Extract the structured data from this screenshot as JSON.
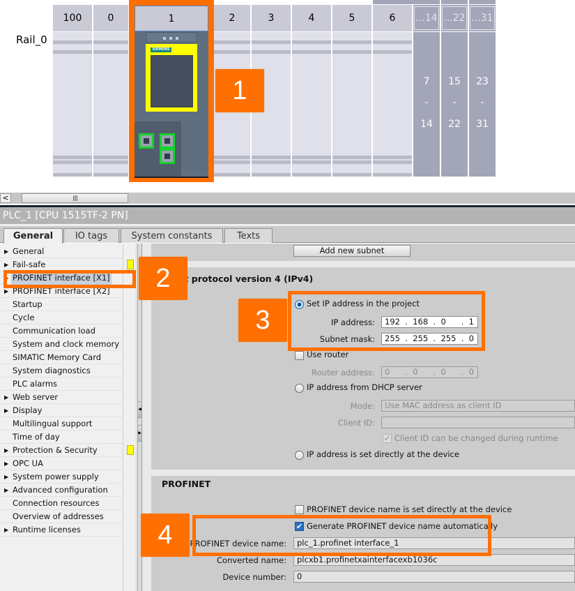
{
  "device_view": {
    "rail_label": "Rail_0",
    "slots": [
      "100",
      "0",
      "1",
      "2",
      "3",
      "4",
      "5",
      "6"
    ],
    "slot_groups": [
      {
        "header": "...14",
        "from": "7",
        "sep": "-",
        "to": "14"
      },
      {
        "header": "...22",
        "from": "15",
        "sep": "-",
        "to": "22"
      },
      {
        "header": "...31",
        "from": "23",
        "sep": "-",
        "to": "31"
      }
    ],
    "cpu_brand": "SIEMENS"
  },
  "callouts": [
    "1",
    "2",
    "3",
    "4"
  ],
  "scrollbar": {
    "left_arrow": "<",
    "thumb_grip": "||||"
  },
  "inspector": {
    "title": "PLC_1 [CPU 1515TF-2 PN]",
    "tabs": [
      {
        "label": "General",
        "active": true
      },
      {
        "label": "IO tags",
        "active": false
      },
      {
        "label": "System constants",
        "active": false
      },
      {
        "label": "Texts",
        "active": false
      }
    ],
    "nav": [
      {
        "label": "General",
        "expandable": true
      },
      {
        "label": "Fail-safe",
        "expandable": true,
        "flag": true
      },
      {
        "label": "PROFINET interface [X1]",
        "expandable": true,
        "selected": true
      },
      {
        "label": "PROFINET interface [X2]",
        "expandable": true
      },
      {
        "label": "Startup"
      },
      {
        "label": "Cycle"
      },
      {
        "label": "Communication load"
      },
      {
        "label": "System and clock memory"
      },
      {
        "label": "SIMATIC Memory Card"
      },
      {
        "label": "System diagnostics"
      },
      {
        "label": "PLC alarms"
      },
      {
        "label": "Web server",
        "expandable": true
      },
      {
        "label": "Display",
        "expandable": true
      },
      {
        "label": "Multilingual support"
      },
      {
        "label": "Time of day"
      },
      {
        "label": "Protection & Security",
        "expandable": true,
        "flag": true
      },
      {
        "label": "OPC UA",
        "expandable": true
      },
      {
        "label": "System power supply",
        "expandable": true
      },
      {
        "label": "Advanced configuration",
        "expandable": true
      },
      {
        "label": "Connection resources"
      },
      {
        "label": "Overview of addresses"
      },
      {
        "label": "Runtime licenses",
        "expandable": true
      }
    ],
    "splitter": {
      "left": "◀",
      "right": "▶"
    },
    "content": {
      "add_subnet_button": "Add new subnet",
      "ipv4_title": "et protocol version 4 (IPv4)",
      "set_ip_in_project": {
        "label": "Set IP address in the project",
        "selected": true
      },
      "ip_address_label": "IP address:",
      "ip_address_value": "192  .  168  .  0      .  1",
      "subnet_mask_label": "Subnet mask:",
      "subnet_mask_value": "255  .  255  .  255  .  0",
      "use_router": {
        "label": "Use router",
        "checked": false
      },
      "router_address_label": "Router address:",
      "router_address_value": "0      .  0      .  0      .  0",
      "dhcp": {
        "label": "IP address from DHCP server",
        "selected": false
      },
      "mode_label": "Mode:",
      "mode_value": "Use MAC address as client ID",
      "client_id_label": "Client ID:",
      "client_id_value": "",
      "client_id_changeable": {
        "label": "Client ID can be changed during runtime",
        "checked": true,
        "disabled": true
      },
      "ip_direct": {
        "label": "IP address is set directly at the device",
        "selected": false
      },
      "profinet_title": "PROFINET",
      "pn_name_direct": {
        "label": "PROFINET device name is set directly at the device",
        "checked": false
      },
      "pn_generate": {
        "label": "Generate PROFINET device name automatically",
        "checked": true
      },
      "pn_device_name_label": "PROFINET device name:",
      "pn_device_name_value": "plc_1.profinet interface_1",
      "converted_name_label": "Converted name:",
      "converted_name_value": "plcxb1.profinetxainterfacexb1036c",
      "device_number_label": "Device number:",
      "device_number_value": "0"
    }
  },
  "colors": {
    "callout": "#ff7000",
    "module_highlight": "#ffff00",
    "port_highlight": "#17d12e"
  }
}
